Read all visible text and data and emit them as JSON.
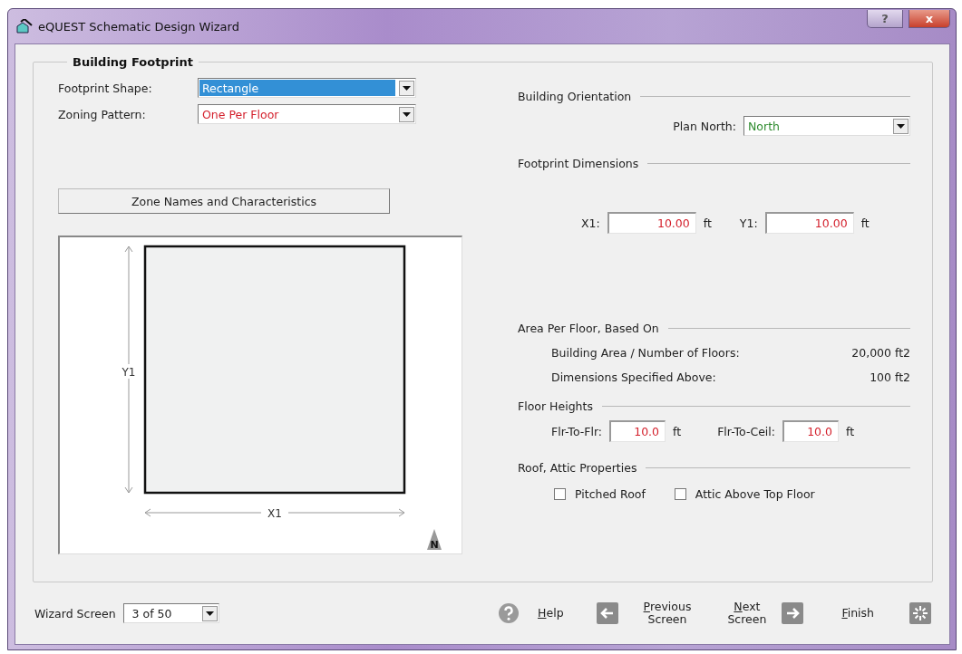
{
  "window": {
    "title": "eQUEST Schematic Design Wizard",
    "help_button": "?",
    "close_button": "x"
  },
  "group": {
    "title": "Building Footprint"
  },
  "combos": [
    {
      "label": "Footprint Shape:",
      "value": "Rectangle",
      "highlighted": true,
      "kind": "user"
    },
    {
      "label": "Zoning Pattern:",
      "value": "One Per Floor",
      "highlighted": false,
      "kind": "user"
    }
  ],
  "zone_button": "Zone Names and Characteristics",
  "diagram": {
    "y_label": "Y1",
    "x_label": "X1",
    "north_label": "N"
  },
  "orientation": {
    "heading": "Building Orientation",
    "label": "Plan North:",
    "value": "North",
    "kind": "default"
  },
  "dimensions": {
    "heading": "Footprint Dimensions",
    "fields": [
      {
        "label": "X1:",
        "value": "10.00",
        "unit": "ft",
        "kind": "user"
      },
      {
        "label": "Y1:",
        "value": "10.00",
        "unit": "ft",
        "kind": "user"
      }
    ]
  },
  "area": {
    "heading": "Area Per Floor, Based On",
    "rows": [
      {
        "label": "Building Area / Number of Floors:",
        "value": "20,000 ft2"
      },
      {
        "label": "Dimensions Specified Above:",
        "value": "100 ft2"
      }
    ]
  },
  "floor_heights": {
    "heading": "Floor Heights",
    "fields": [
      {
        "label": "Flr-To-Flr:",
        "value": "10.0",
        "unit": "ft",
        "kind": "user"
      },
      {
        "label": "Flr-To-Ceil:",
        "value": "10.0",
        "unit": "ft",
        "kind": "user"
      }
    ]
  },
  "roof": {
    "heading": "Roof, Attic Properties",
    "options": [
      {
        "label": "Pitched Roof",
        "checked": false
      },
      {
        "label": "Attic Above Top Floor",
        "checked": false
      }
    ]
  },
  "footer": {
    "wizard_label": "Wizard Screen",
    "wizard_value": "3 of 50",
    "help": "Help",
    "previous": [
      "Previous",
      "Screen"
    ],
    "next": [
      "Next",
      "Screen"
    ],
    "finish": "Finish"
  }
}
